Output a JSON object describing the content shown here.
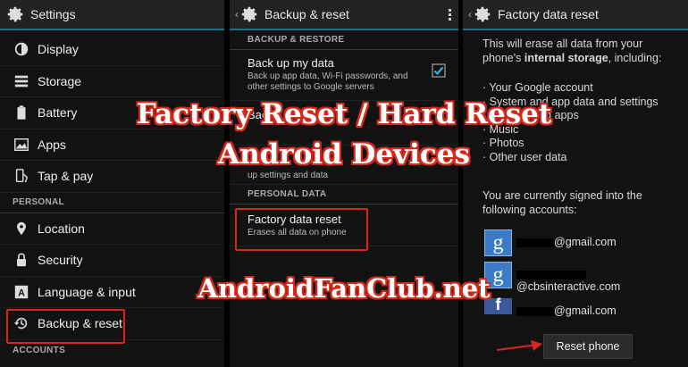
{
  "colors": {
    "accent": "#1f6f8b",
    "highlight": "#d8261d",
    "overlay_outline": "#d32a1c",
    "checkbox": "#33b5e5"
  },
  "settings": {
    "title": "Settings",
    "items_top": [
      {
        "icon": "display-icon",
        "label": "Display"
      },
      {
        "icon": "storage-icon",
        "label": "Storage"
      },
      {
        "icon": "battery-icon",
        "label": "Battery"
      },
      {
        "icon": "apps-icon",
        "label": "Apps"
      },
      {
        "icon": "tap-pay-icon",
        "label": "Tap & pay"
      }
    ],
    "section_personal": "PERSONAL",
    "items_personal": [
      {
        "icon": "location-icon",
        "label": "Location"
      },
      {
        "icon": "lock-icon",
        "label": "Security"
      },
      {
        "icon": "language-icon",
        "label": "Language & input"
      },
      {
        "icon": "backup-icon",
        "label": "Backup & reset"
      }
    ],
    "section_accounts": "ACCOUNTS"
  },
  "backup": {
    "title": "Backup & reset",
    "section_backup": "BACKUP & RESTORE",
    "backup_my_data": {
      "title": "Back up my data",
      "summary": "Back up app data, Wi-Fi passwords, and other settings to Google servers",
      "checked": true
    },
    "backup_account_partial": "Bac",
    "auto_restore_summary": "up settings and data",
    "section_personal": "PERSONAL DATA",
    "factory_reset": {
      "title": "Factory data reset",
      "summary": "Erases all data on phone"
    }
  },
  "factory": {
    "title": "Factory data reset",
    "intro_a": "This will erase all data from your phone's",
    "intro_bold": "internal storage",
    "intro_b": ", including:",
    "list": [
      "· Your Google account",
      "· System and app data and settings",
      "· Downloaded apps",
      "· Music",
      "· Photos",
      "· Other user data"
    ],
    "signed_in": "You are currently signed into the following accounts:",
    "accounts": [
      {
        "type": "google",
        "suffix": "@gmail.com"
      },
      {
        "type": "google",
        "suffix": "@cbsinteractive.com"
      },
      {
        "type": "facebook",
        "suffix": "@gmail.com"
      }
    ],
    "reset_button": "Reset phone"
  },
  "overlay": {
    "line1": "Factory Reset / Hard Reset",
    "line2": "Android Devices",
    "line3": "AndroidFanClub.net"
  }
}
